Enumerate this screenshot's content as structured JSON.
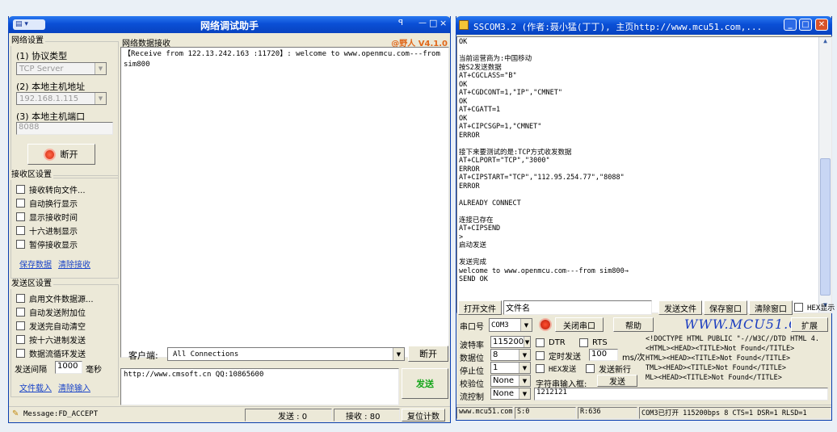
{
  "left": {
    "title": "网络调试助手",
    "titlebar_controls": {
      "pin": "ꟼ",
      "min": "—",
      "max": "□",
      "close": "×"
    },
    "net_settings": {
      "legend": "网络设置",
      "protocol_label": "(1) 协议类型",
      "protocol_value": "TCP Server",
      "local_ip_label": "(2) 本地主机地址",
      "local_ip_value": "192.168.1.115",
      "local_port_label": "(3) 本地主机端口",
      "local_port_value": "8088",
      "connect_button": "断开"
    },
    "recv_settings": {
      "legend": "接收区设置",
      "options": [
        "接收转向文件...",
        "自动换行显示",
        "显示接收时间",
        "十六进制显示",
        "暂停接收显示"
      ],
      "save_link": "保存数据",
      "clear_link": "清除接收"
    },
    "send_settings": {
      "legend": "发送区设置",
      "options": [
        "启用文件数据源...",
        "自动发送附加位",
        "发送完自动清空",
        "按十六进制发送",
        "数据流循环发送"
      ],
      "interval_label": "发送间隔",
      "interval_value": "1000",
      "interval_unit": "毫秒",
      "load_link": "文件载入",
      "clear_link": "清除输入"
    },
    "recv_area": {
      "legend": "网络数据接收",
      "version": "@野人 V4.1.0",
      "text": "【Receive from 122.13.242.163 :11720】: welcome to www.openmcu.com---from sim800"
    },
    "client_label": "客户端:",
    "client_value": "All Connections",
    "disconnect_button": "断开",
    "send_text": "http://www.cmsoft.cn QQ:10865600",
    "send_button": "发送",
    "status": {
      "message": "Message:FD_ACCEPT",
      "sent": "发送 : 0",
      "received": "接收 : 80",
      "reset_button": "复位计数"
    }
  },
  "right": {
    "title": "SSCOM3.2 (作者:聂小猛(丁丁), 主页http://www.mcu51.com,...",
    "log_lines": [
      "OK",
      "",
      "当前运营商为:中国移动",
      "按S2发送数据",
      "AT+CGCLASS=\"B\"",
      "OK",
      "AT+CGDCONT=1,\"IP\",\"CMNET\"",
      "OK",
      "AT+CGATT=1",
      "OK",
      "AT+CIPCSGP=1,\"CMNET\"",
      "ERROR",
      "",
      "接下来要测试的是:TCP方式收发数据",
      "AT+CLPORT=\"TCP\",\"3000\"",
      "ERROR",
      "AT+CIPSTART=\"TCP\",\"112.95.254.77\",\"8088\"",
      "ERROR",
      "",
      "ALREADY CONNECT",
      "",
      "连接已存在",
      "AT+CIPSEND",
      ">",
      "启动发送",
      "",
      "发送完成",
      "welcome to www.openmcu.com---from sim800→",
      "SEND OK"
    ],
    "toolbar1": {
      "open_file": "打开文件",
      "filename": "文件名",
      "send_file": "发送文件",
      "save_window": "保存窗口",
      "clear_window": "清除窗口",
      "hex_display": "HEX显示"
    },
    "toolbar2": {
      "port_label": "串口号",
      "port_value": "COM3",
      "close_port": "关闭串口",
      "help": "帮助",
      "brand": "WWW.MCU51.COM",
      "expand": "扩展"
    },
    "settings": {
      "baud_label": "波特率",
      "baud_value": "115200",
      "databits_label": "数据位",
      "databits_value": "8",
      "stopbits_label": "停止位",
      "stopbits_value": "1",
      "parity_label": "校验位",
      "parity_value": "None",
      "flow_label": "流控制",
      "flow_value": "None",
      "dtr": "DTR",
      "rts": "RTS",
      "timed_send": "定时发送",
      "timed_value": "100",
      "timed_unit": "ms/次",
      "hex_send": "HEX发送",
      "send_newline": "发送新行",
      "input_label": "字符串输入框:",
      "send_button": "发送",
      "input_value": "1212121"
    },
    "preview_lines": [
      "<!DOCTYPE HTML PUBLIC \"-//W3C//DTD HTML 4.",
      "<HTML><HEAD><TITLE>Not Found</TITLE>",
      "HTML><HEAD><TITLE>Not Found</TITLE>",
      "TML><HEAD><TITLE>Not Found</TITLE>",
      "ML><HEAD><TITLE>Not Found</TITLE>"
    ],
    "status": {
      "site": "www.mcu51.com",
      "s": "S:0",
      "r": "R:636",
      "port_info": "COM3已打开  115200bps  8  CTS=1 DSR=1 RLSD=1"
    }
  }
}
